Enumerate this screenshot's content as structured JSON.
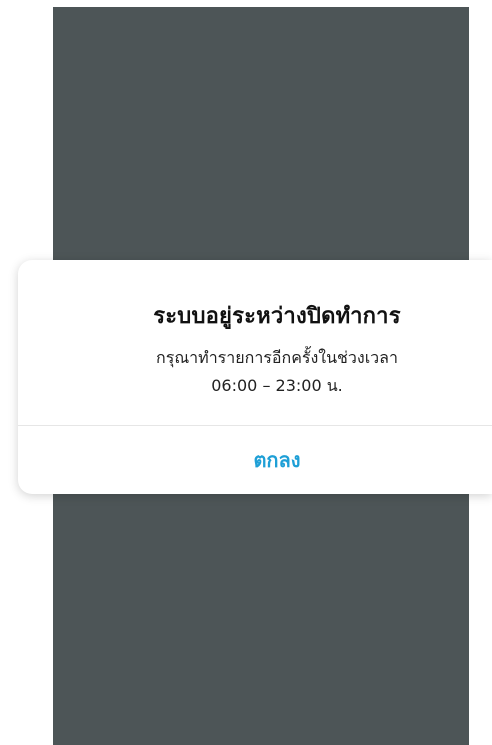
{
  "alert": {
    "title": "ระบบอยู่ระหว่างปิดทำการ",
    "message_line1": "กรุณาทำรายการอีกครั้งในช่วงเวลา",
    "message_line2": "06:00 – 23:00 น.",
    "ok_label": "ตกลง"
  },
  "colors": {
    "overlay": "#4d5557",
    "accent": "#1e9fd6",
    "dialog_bg": "#ffffff"
  }
}
